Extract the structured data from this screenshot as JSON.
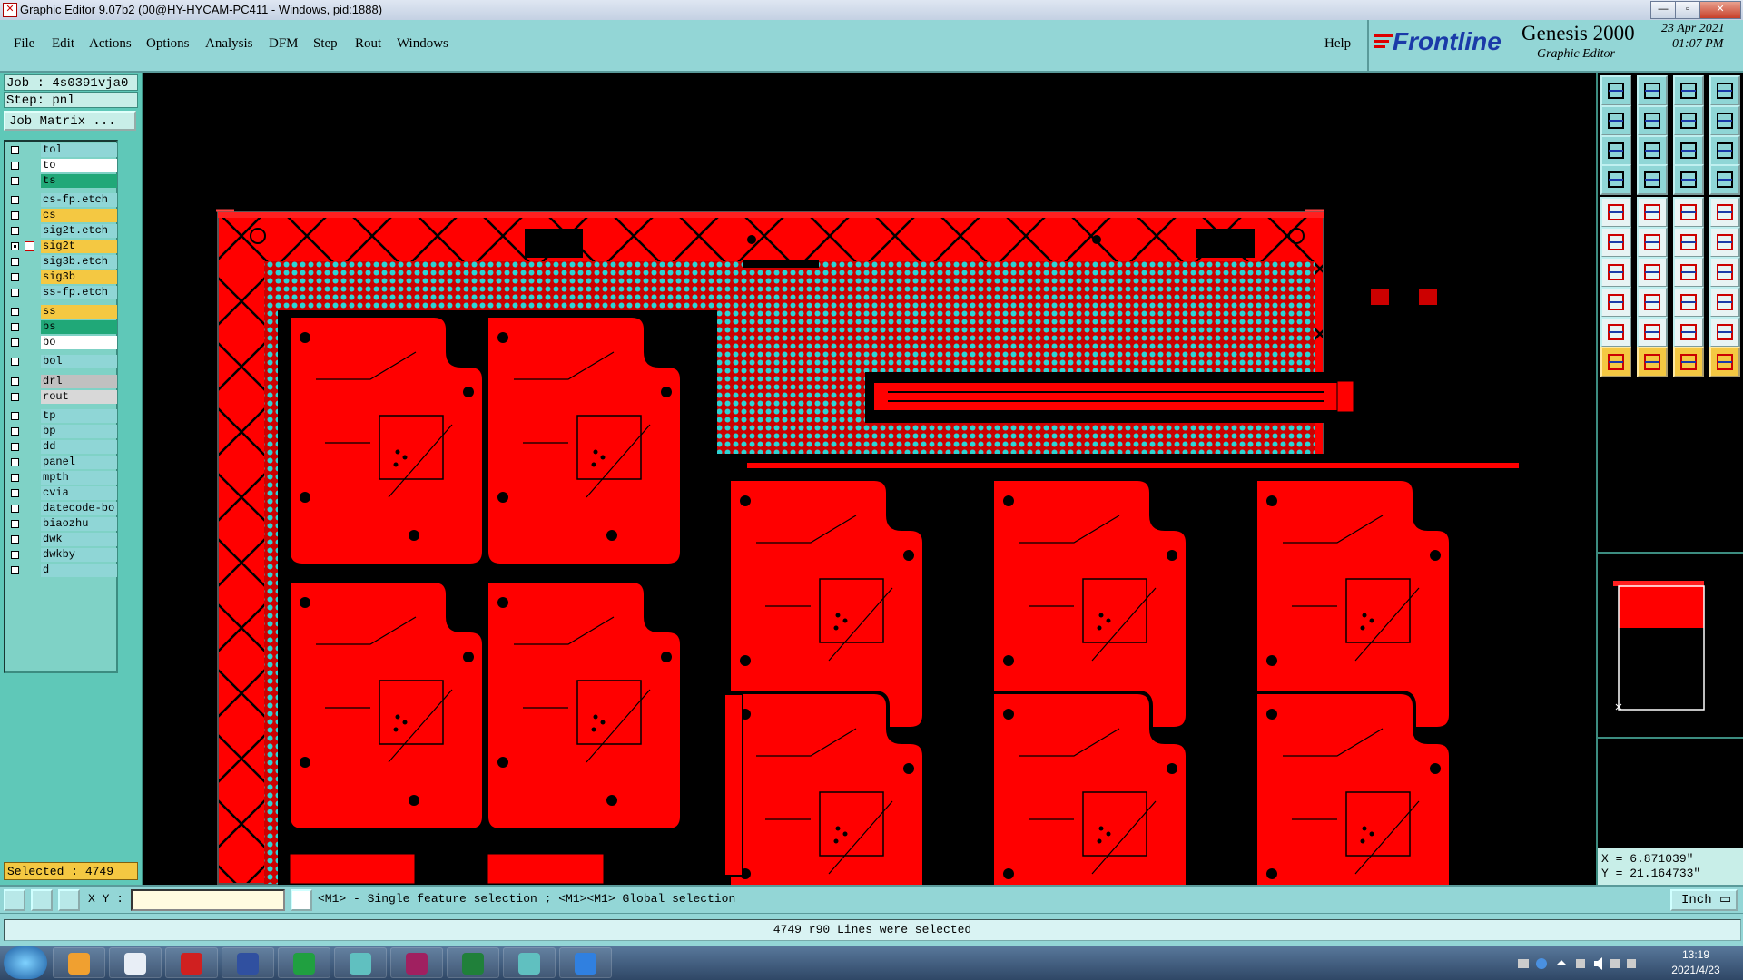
{
  "window": {
    "title": "Graphic Editor 9.07b2 (00@HY-HYCAM-PC411 - Windows, pid:1888)"
  },
  "menu": [
    "File",
    "Edit",
    "Actions",
    "Options",
    "Analysis",
    "DFM",
    "Step",
    "Rout",
    "Windows"
  ],
  "help": "Help",
  "brand": {
    "logo": "Frontline",
    "product": "Genesis 2000",
    "subtitle": "Graphic Editor",
    "date": "23 Apr 2021",
    "time": "01:07 PM"
  },
  "job": {
    "job_line": "Job : 4s0391vja0",
    "step_line": "Step: pnl",
    "matrix_button": "Job Matrix ..."
  },
  "layers": [
    {
      "name": "tol",
      "color": "#8fd6d6",
      "checked": false
    },
    {
      "name": "to",
      "color": "#ffffff",
      "checked": false
    },
    {
      "name": "ts",
      "color": "#20a878",
      "checked": false
    },
    {
      "name": "cs-fp.etch",
      "color": "#8fd6d6",
      "checked": false
    },
    {
      "name": "cs",
      "color": "#f4c842",
      "checked": false
    },
    {
      "name": "sig2t.etch",
      "color": "#8fd6d6",
      "checked": false
    },
    {
      "name": "sig2t",
      "color": "#f4c842",
      "checked": true,
      "active": true
    },
    {
      "name": "sig3b.etch",
      "color": "#8fd6d6",
      "checked": false
    },
    {
      "name": "sig3b",
      "color": "#f4c842",
      "checked": false
    },
    {
      "name": "ss-fp.etch",
      "color": "#8fd6d6",
      "checked": false
    },
    {
      "name": "ss",
      "color": "#f4c842",
      "checked": false
    },
    {
      "name": "bs",
      "color": "#20a878",
      "checked": false
    },
    {
      "name": "bo",
      "color": "#ffffff",
      "checked": false
    },
    {
      "name": "bol",
      "color": "#8fd6d6",
      "checked": false
    },
    {
      "name": "drl",
      "color": "#c0c0c0",
      "checked": false
    },
    {
      "name": "rout",
      "color": "#d8d8d8",
      "checked": false
    },
    {
      "name": "tp",
      "color": "#8fd6d6",
      "checked": false
    },
    {
      "name": "bp",
      "color": "#8fd6d6",
      "checked": false
    },
    {
      "name": "dd",
      "color": "#8fd6d6",
      "checked": false
    },
    {
      "name": "panel",
      "color": "#8fd6d6",
      "checked": false
    },
    {
      "name": "mpth",
      "color": "#8fd6d6",
      "checked": false
    },
    {
      "name": "cvia",
      "color": "#8fd6d6",
      "checked": false
    },
    {
      "name": "datecode-bo",
      "color": "#8fd6d6",
      "checked": false
    },
    {
      "name": "biaozhu",
      "color": "#8fd6d6",
      "checked": false
    },
    {
      "name": "dwk",
      "color": "#8fd6d6",
      "checked": false
    },
    {
      "name": "dwkby",
      "color": "#8fd6d6",
      "checked": false
    },
    {
      "name": "d",
      "color": "#8fd6d6",
      "checked": false
    }
  ],
  "selected": "Selected : 4749",
  "coords": {
    "x": "X = 6.871039\"",
    "y": "Y = 21.164733\""
  },
  "command": {
    "xy_label": "X Y :",
    "xy_value": "",
    "hint": "<M1> - Single feature selection ; <M1><M1> Global selection",
    "unit": "Inch"
  },
  "message": "4749 r90 Lines were selected",
  "taskbar": {
    "time": "13:19",
    "date": "2021/4/23"
  },
  "colors": {
    "board": "#ff0000",
    "copper_gap": "#000000",
    "dots": "#2cd4d4",
    "panel_bg": "#93d6d6"
  }
}
